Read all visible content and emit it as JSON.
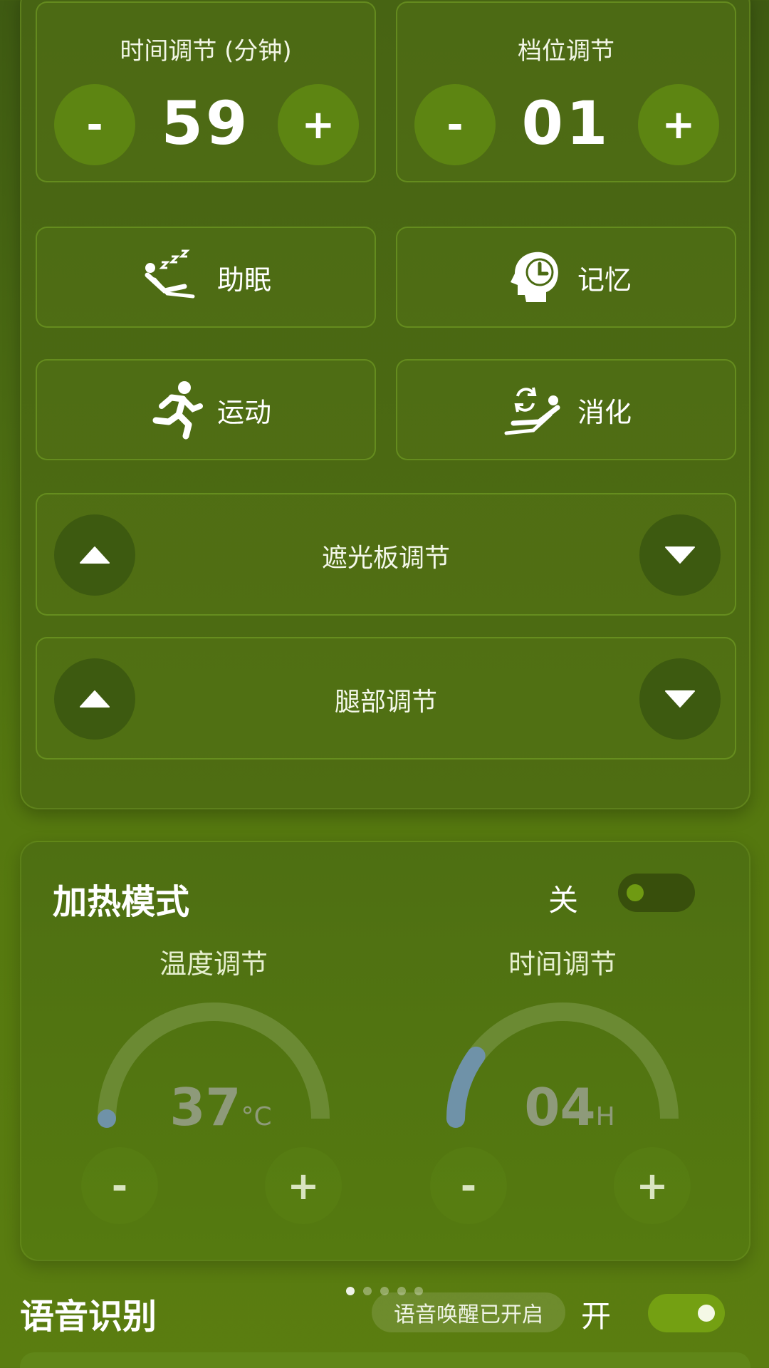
{
  "timer": {
    "title": "时间调节 (分钟)",
    "value": "59",
    "minus": "-",
    "plus": "+"
  },
  "gear": {
    "title": "档位调节",
    "value": "01",
    "minus": "-",
    "plus": "+"
  },
  "modes": [
    {
      "label": "助眠",
      "icon": "sleep-recline-icon"
    },
    {
      "label": "记忆",
      "icon": "memory-clock-head-icon"
    },
    {
      "label": "运动",
      "icon": "running-icon"
    },
    {
      "label": "消化",
      "icon": "digest-recline-icon"
    }
  ],
  "adjust": [
    {
      "label": "遮光板调节",
      "up_icon": "triangle-up-icon",
      "down_icon": "triangle-down-icon"
    },
    {
      "label": "腿部调节",
      "up_icon": "triangle-up-icon",
      "down_icon": "triangle-down-icon"
    }
  ],
  "heat": {
    "title": "加热模式",
    "switch_label": "关",
    "switch_on": false,
    "temp": {
      "title": "温度调节",
      "value": "37",
      "unit": "°C",
      "progress": 0.0,
      "minus": "-",
      "plus": "+"
    },
    "time": {
      "title": "时间调节",
      "value": "04",
      "unit": "H",
      "progress": 0.2,
      "minus": "-",
      "plus": "+"
    }
  },
  "voice": {
    "title": "语音识别",
    "status": "语音唤醒已开启",
    "switch_label": "开",
    "switch_on": true,
    "page_dots": 5,
    "active_dot": 0
  },
  "colors": {
    "accent_green": "#5d8512",
    "gauge_track": "#6b8a33",
    "gauge_progress": "#6f92a8",
    "toggle_on": "#74a012",
    "toggle_off": "#384f0c"
  }
}
